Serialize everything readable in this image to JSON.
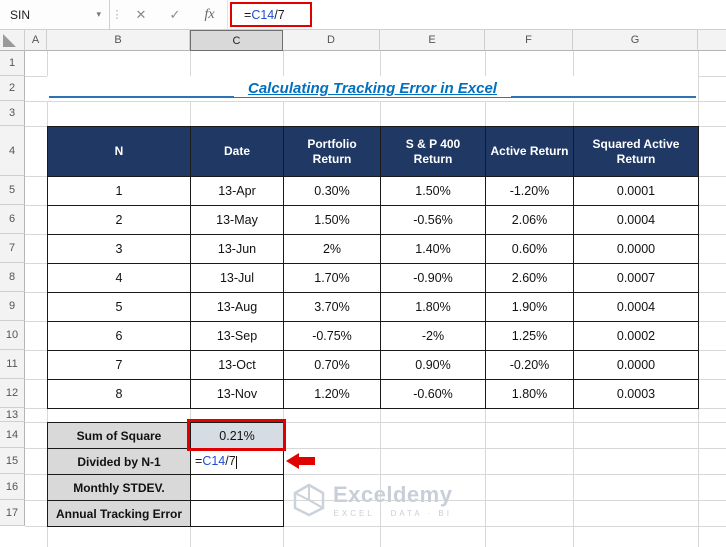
{
  "formula_bar": {
    "name_box": "SIN",
    "caret_icon": "▾",
    "dots_icon": "⋮",
    "cancel_icon": "✕",
    "enter_icon": "✓",
    "fx_icon": "fx"
  },
  "formula": {
    "eq": "=",
    "ref": "C14",
    "rest": "/7"
  },
  "columns": [
    "A",
    "B",
    "C",
    "D",
    "E",
    "F",
    "G"
  ],
  "rows": [
    "1",
    "2",
    "3",
    "4",
    "5",
    "6",
    "7",
    "8",
    "9",
    "10",
    "11",
    "12",
    "13",
    "14",
    "15",
    "16",
    "17"
  ],
  "title": "Calculating Tracking Error in Excel",
  "main_table": {
    "headers": [
      "N",
      "Date",
      "Portfolio Return",
      "S & P 400 Return",
      "Active Return",
      "Squared Active Return"
    ],
    "rows": [
      [
        "1",
        "13-Apr",
        "0.30%",
        "1.50%",
        "-1.20%",
        "0.0001"
      ],
      [
        "2",
        "13-May",
        "1.50%",
        "-0.56%",
        "2.06%",
        "0.0004"
      ],
      [
        "3",
        "13-Jun",
        "2%",
        "1.40%",
        "0.60%",
        "0.0000"
      ],
      [
        "4",
        "13-Jul",
        "1.70%",
        "-0.90%",
        "2.60%",
        "0.0007"
      ],
      [
        "5",
        "13-Aug",
        "3.70%",
        "1.80%",
        "1.90%",
        "0.0004"
      ],
      [
        "6",
        "13-Sep",
        "-0.75%",
        "-2%",
        "1.25%",
        "0.0002"
      ],
      [
        "7",
        "13-Oct",
        "0.70%",
        "0.90%",
        "-0.20%",
        "0.0000"
      ],
      [
        "8",
        "13-Nov",
        "1.20%",
        "-0.60%",
        "1.80%",
        "0.0003"
      ]
    ]
  },
  "summary": {
    "rows": [
      {
        "label": "Sum of Square",
        "value": "0.21%"
      },
      {
        "label": "Divided by N-1",
        "value": "=C14/7"
      },
      {
        "label": "Monthly STDEV.",
        "value": ""
      },
      {
        "label": "Annual Tracking Error",
        "value": ""
      }
    ]
  },
  "watermark": {
    "brand": "Exceldemy",
    "tagline": "EXCEL · DATA · BI"
  },
  "colors": {
    "table_header_navy": "#1F3864",
    "label_gray": "#D9D9D9",
    "highlight_cell_blue": "#D6DCE4",
    "title_blue": "#0070C0",
    "title_line_blue": "#2E74B5",
    "annotation_red": "#E00000",
    "formula_ref_blue": "#1F4FD1"
  }
}
